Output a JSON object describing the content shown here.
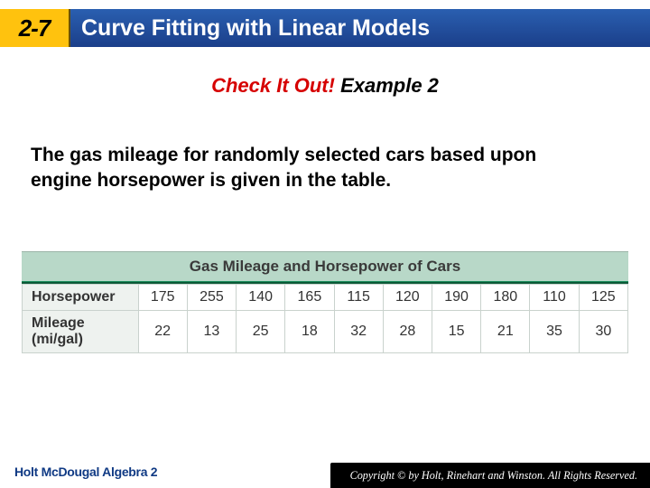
{
  "header": {
    "lesson_code": "2-7",
    "title": "Curve Fitting with Linear Models"
  },
  "check_it_out": {
    "red": "Check It Out!",
    "black": " Example 2"
  },
  "body": "The gas mileage for randomly selected cars based upon engine horsepower is given in the table.",
  "table": {
    "title": "Gas Mileage and Horsepower of Cars",
    "row1_label": "Horsepower",
    "row2_label": "Mileage (mi/gal)",
    "hp": [
      "175",
      "255",
      "140",
      "165",
      "115",
      "120",
      "190",
      "180",
      "110",
      "125"
    ],
    "mileage": [
      "22",
      "13",
      "25",
      "18",
      "32",
      "28",
      "15",
      "21",
      "35",
      "30"
    ]
  },
  "footer": {
    "left": "Holt McDougal Algebra 2",
    "right": "Copyright © by Holt, Rinehart and Winston. All Rights Reserved."
  },
  "chart_data": {
    "type": "table",
    "title": "Gas Mileage and Horsepower of Cars",
    "columns": 10,
    "series": [
      {
        "name": "Horsepower",
        "values": [
          175,
          255,
          140,
          165,
          115,
          120,
          190,
          180,
          110,
          125
        ]
      },
      {
        "name": "Mileage (mi/gal)",
        "values": [
          22,
          13,
          25,
          18,
          32,
          28,
          15,
          21,
          35,
          30
        ]
      }
    ]
  }
}
